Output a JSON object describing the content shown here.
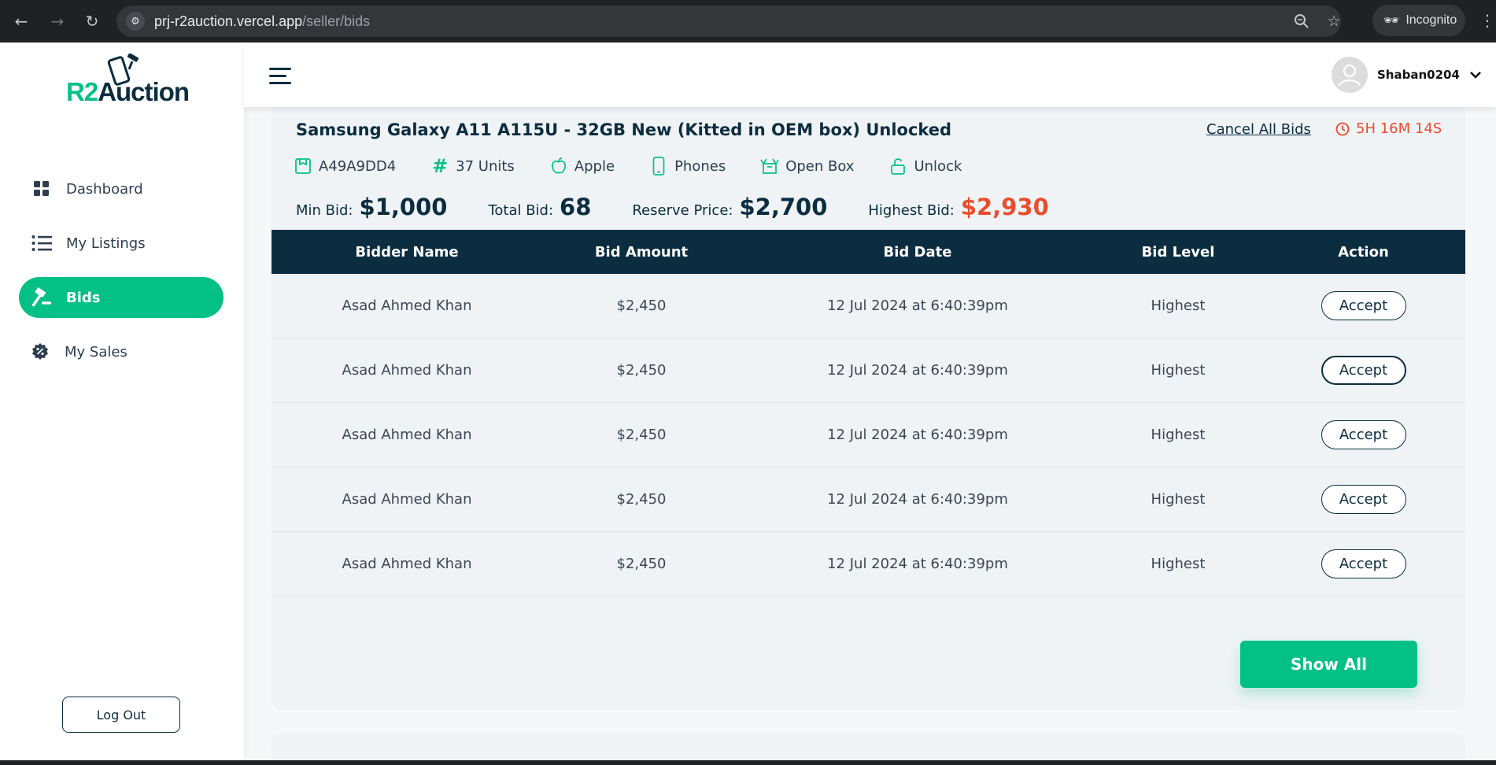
{
  "browser": {
    "url_host": "prj-r2auction.vercel.app",
    "url_path": "/seller/bids",
    "incognito_label": "Incognito"
  },
  "app": {
    "logo": {
      "part1": "R2",
      "part2": "Auction"
    },
    "nav": [
      {
        "label": "Dashboard",
        "icon": "grid-icon"
      },
      {
        "label": "My Listings",
        "icon": "list-icon"
      },
      {
        "label": "Bids",
        "icon": "gavel-icon",
        "active": true
      },
      {
        "label": "My Sales",
        "icon": "sales-badge-icon"
      }
    ],
    "logout_label": "Log Out",
    "user": {
      "name": "Shaban0204"
    },
    "colors": {
      "brand": "#03c185",
      "navy": "#0b2d3f",
      "accent_red": "#ea4d2c"
    }
  },
  "listing": {
    "title": "Samsung Galaxy A11 A115U - 32GB New (Kitted in OEM box) Unlocked",
    "cancel_all_label": "Cancel All Bids",
    "timer": "5H 16M 14S",
    "specs": [
      {
        "icon": "sku-icon",
        "label": "A49A9DD4"
      },
      {
        "icon": "hash-icon",
        "label": "37 Units"
      },
      {
        "icon": "apple-icon",
        "label": "Apple"
      },
      {
        "icon": "phone-icon",
        "label": "Phones"
      },
      {
        "icon": "box-icon",
        "label": "Open Box"
      },
      {
        "icon": "unlock-icon",
        "label": "Unlock"
      }
    ],
    "summary": {
      "min_bid_label": "Min Bid:",
      "min_bid": "$1,000",
      "total_bid_label": "Total Bid:",
      "total_bid": "68",
      "reserve_label": "Reserve Price:",
      "reserve": "$2,700",
      "highest_label": "Highest Bid:",
      "highest": "$2,930"
    }
  },
  "table": {
    "headers": [
      "Bidder Name",
      "Bid Amount",
      "Bid Date",
      "Bid Level",
      "Action"
    ],
    "rows": [
      {
        "name": "Asad Ahmed Khan",
        "amount": "$2,450",
        "date": "12 Jul 2024 at 6:40:39pm",
        "level": "Highest",
        "action": "Accept"
      },
      {
        "name": "Asad Ahmed Khan",
        "amount": "$2,450",
        "date": "12 Jul 2024 at 6:40:39pm",
        "level": "Highest",
        "action": "Accept"
      },
      {
        "name": "Asad Ahmed Khan",
        "amount": "$2,450",
        "date": "12 Jul 2024 at 6:40:39pm",
        "level": "Highest",
        "action": "Accept"
      },
      {
        "name": "Asad Ahmed Khan",
        "amount": "$2,450",
        "date": "12 Jul 2024 at 6:40:39pm",
        "level": "Highest",
        "action": "Accept"
      },
      {
        "name": "Asad Ahmed Khan",
        "amount": "$2,450",
        "date": "12 Jul 2024 at 6:40:39pm",
        "level": "Highest",
        "action": "Accept"
      }
    ],
    "show_all_label": "Show All"
  }
}
